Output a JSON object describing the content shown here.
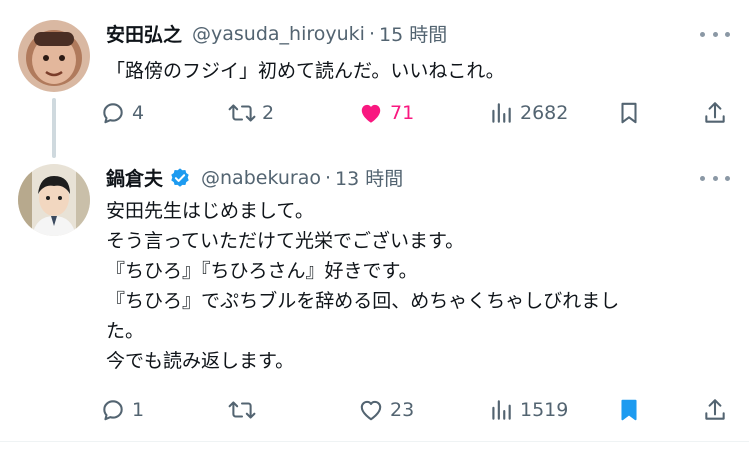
{
  "tweets": [
    {
      "name": "安田弘之",
      "handle": "@yasuda_hiroyuki",
      "separator": "·",
      "time": "15 時間",
      "text": "「路傍のフジイ」初めて読んだ。いいねこれ。",
      "replies": "4",
      "retweets": "2",
      "likes": "71",
      "liked": true,
      "views": "2682",
      "bookmarked": false
    },
    {
      "name": "鍋倉夫",
      "verified": true,
      "handle": "@nabekurao",
      "separator": "·",
      "time": "13 時間",
      "text": "安田先生はじめまして。\nそう言っていただけて光栄でございます。\n『ちひろ』『ちひろさん』好きです。\n『ちひろ』でぷちブルを辞める回、めちゃくちゃしびれまし\nた。\n今でも読み返します。",
      "replies": "1",
      "retweets": "",
      "likes": "23",
      "liked": false,
      "views": "1519",
      "bookmarked": true
    }
  ],
  "colors": {
    "accent": "#1d9bf0",
    "like": "#f91880",
    "muted": "#536471"
  },
  "icons": [
    "reply-icon",
    "retweet-icon",
    "like-icon",
    "views-icon",
    "bookmark-icon",
    "share-icon",
    "more-icon",
    "verified-badge-icon"
  ]
}
